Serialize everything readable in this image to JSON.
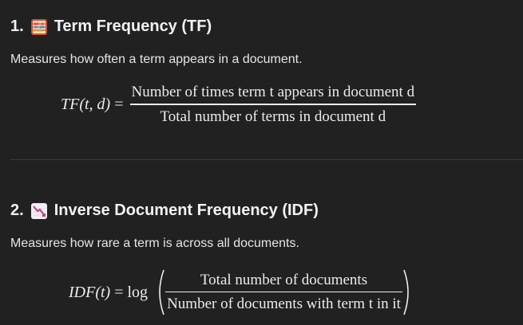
{
  "tf": {
    "number": "1.",
    "title": "Term Frequency (TF)",
    "icon": "abacus-icon",
    "description": "Measures how often a term appears in a document.",
    "lhs_name": "TF",
    "lhs_args": "(t, d)",
    "equals": "=",
    "numerator": "Number of times term t appears in document d",
    "denominator": "Total number of terms in document d"
  },
  "idf": {
    "number": "2.",
    "title": "Inverse Document Frequency (IDF)",
    "icon": "chart-decreasing-icon",
    "description": "Measures how rare a term is across all documents.",
    "lhs_name": "IDF",
    "lhs_args": "(t)",
    "equals": "=",
    "log": "log",
    "numerator": "Total number of documents",
    "denominator": "Number of documents with term t in it"
  }
}
